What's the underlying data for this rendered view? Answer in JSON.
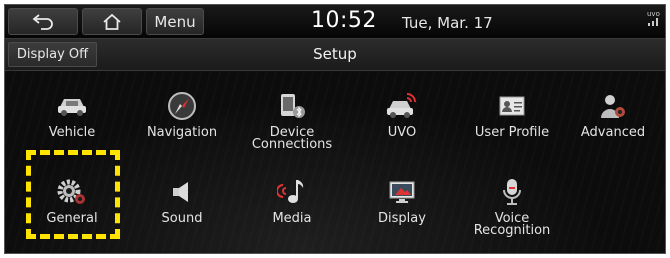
{
  "status_bar": {
    "back_icon": "back-arrow-icon",
    "home_icon": "home-icon",
    "menu_label": "Menu",
    "time": "10:52",
    "date": "Tue, Mar. 17",
    "signal_text": "uvo",
    "signal_icon": "signal-icon"
  },
  "title_bar": {
    "display_off_label": "Display Off",
    "title": "Setup"
  },
  "settings": {
    "row1": [
      {
        "label": "Vehicle",
        "icon": "car-icon"
      },
      {
        "label": "Navigation",
        "icon": "compass-icon"
      },
      {
        "label": "Device\nConnections",
        "icon": "phone-bluetooth-icon"
      },
      {
        "label": "UVO",
        "icon": "car-signal-icon"
      },
      {
        "label": "User Profile",
        "icon": "profile-card-icon"
      },
      {
        "label": "Advanced",
        "icon": "person-gear-icon"
      }
    ],
    "row2": [
      {
        "label": "General",
        "icon": "gears-icon"
      },
      {
        "label": "Sound",
        "icon": "speaker-icon"
      },
      {
        "label": "Media",
        "icon": "music-note-icon"
      },
      {
        "label": "Display",
        "icon": "monitor-icon"
      },
      {
        "label": "Voice\nRecognition",
        "icon": "microphone-icon"
      }
    ]
  },
  "highlight": {
    "target": "General",
    "color": "#ffe400"
  }
}
